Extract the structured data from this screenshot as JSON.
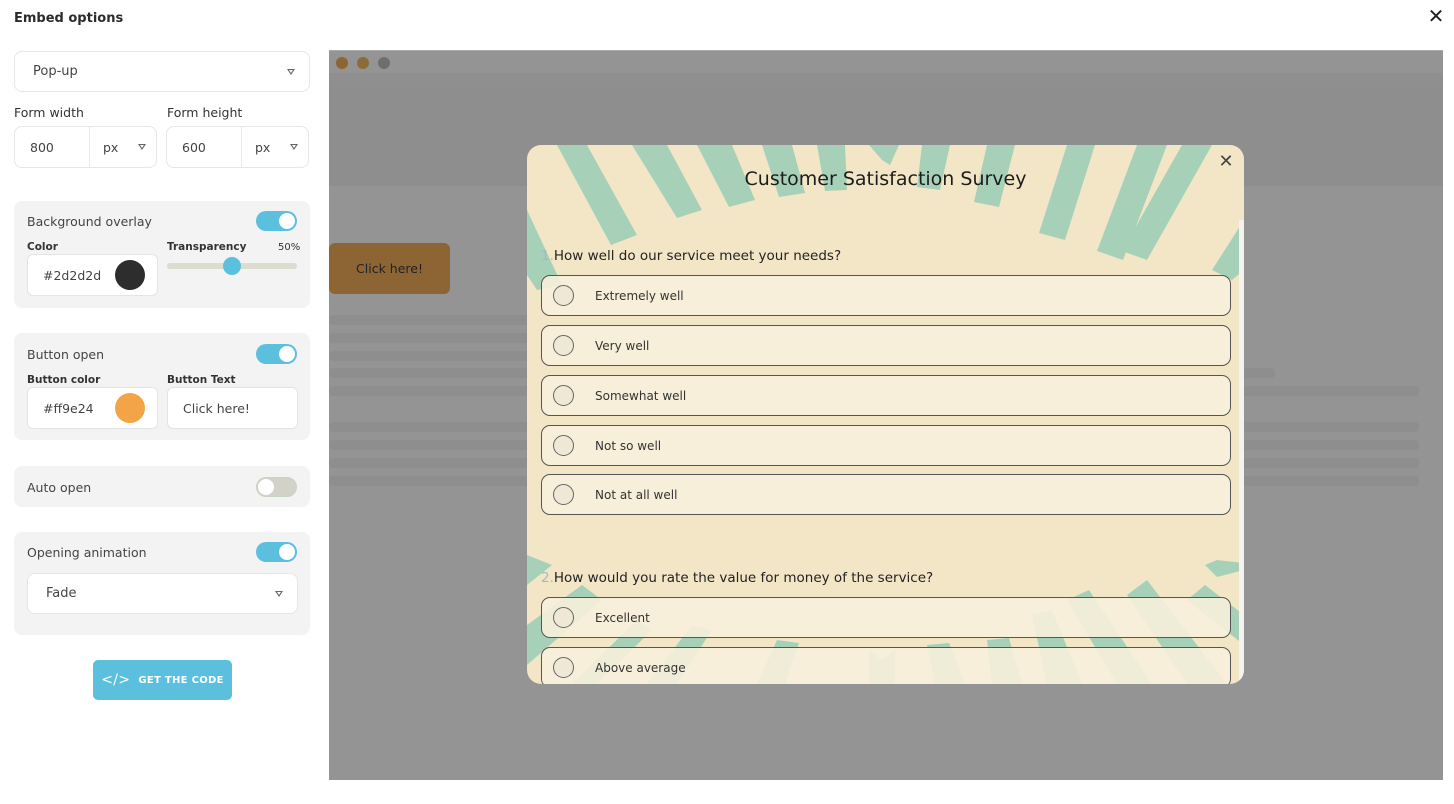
{
  "header": {
    "title": "Embed options",
    "close_icon": "close-icon"
  },
  "embed_type": {
    "value": "Pop-up"
  },
  "form_size": {
    "width_label": "Form width",
    "width_value": "800",
    "width_unit": "px",
    "height_label": "Form height",
    "height_value": "600",
    "height_unit": "px"
  },
  "background_overlay": {
    "title": "Background overlay",
    "enabled": true,
    "color_label": "Color",
    "color_value": "#2d2d2d",
    "color_swatch": "#2d2d2d",
    "transparency_label": "Transparency",
    "transparency_value": "50%",
    "transparency_fraction": 0.5
  },
  "button_open": {
    "title": "Button open",
    "enabled": true,
    "color_label": "Button color",
    "color_value": "#ff9e24",
    "color_swatch": "#f3a447",
    "text_label": "Button Text",
    "text_value": "Click here!"
  },
  "auto_open": {
    "title": "Auto open",
    "enabled": false
  },
  "opening_animation": {
    "title": "Opening animation",
    "enabled": true,
    "value": "Fade"
  },
  "get_code": {
    "icon": "code-icon",
    "label": "GET THE CODE"
  },
  "preview": {
    "window_dots": [
      "#8d6535",
      "#8d6a3a",
      "#6f6f6a"
    ],
    "page_button_label": "Click here!",
    "page_button_color": "#8d6535",
    "survey": {
      "title": "Customer Satisfaction Survey",
      "questions": [
        {
          "number": "1.",
          "text": "How well do our service meet your needs?",
          "options": [
            "Extremely well",
            "Very well",
            "Somewhat well",
            "Not so well",
            "Not at all well"
          ]
        },
        {
          "number": "2.",
          "text": "How would you rate the value for money of the service?",
          "options": [
            "Excellent",
            "Above average"
          ]
        }
      ]
    }
  },
  "colors": {
    "accent": "#5bc0de",
    "survey_bg": "#f3e6c6",
    "survey_stripe": "#a6d1b8",
    "overlay_gray": "#949494"
  }
}
